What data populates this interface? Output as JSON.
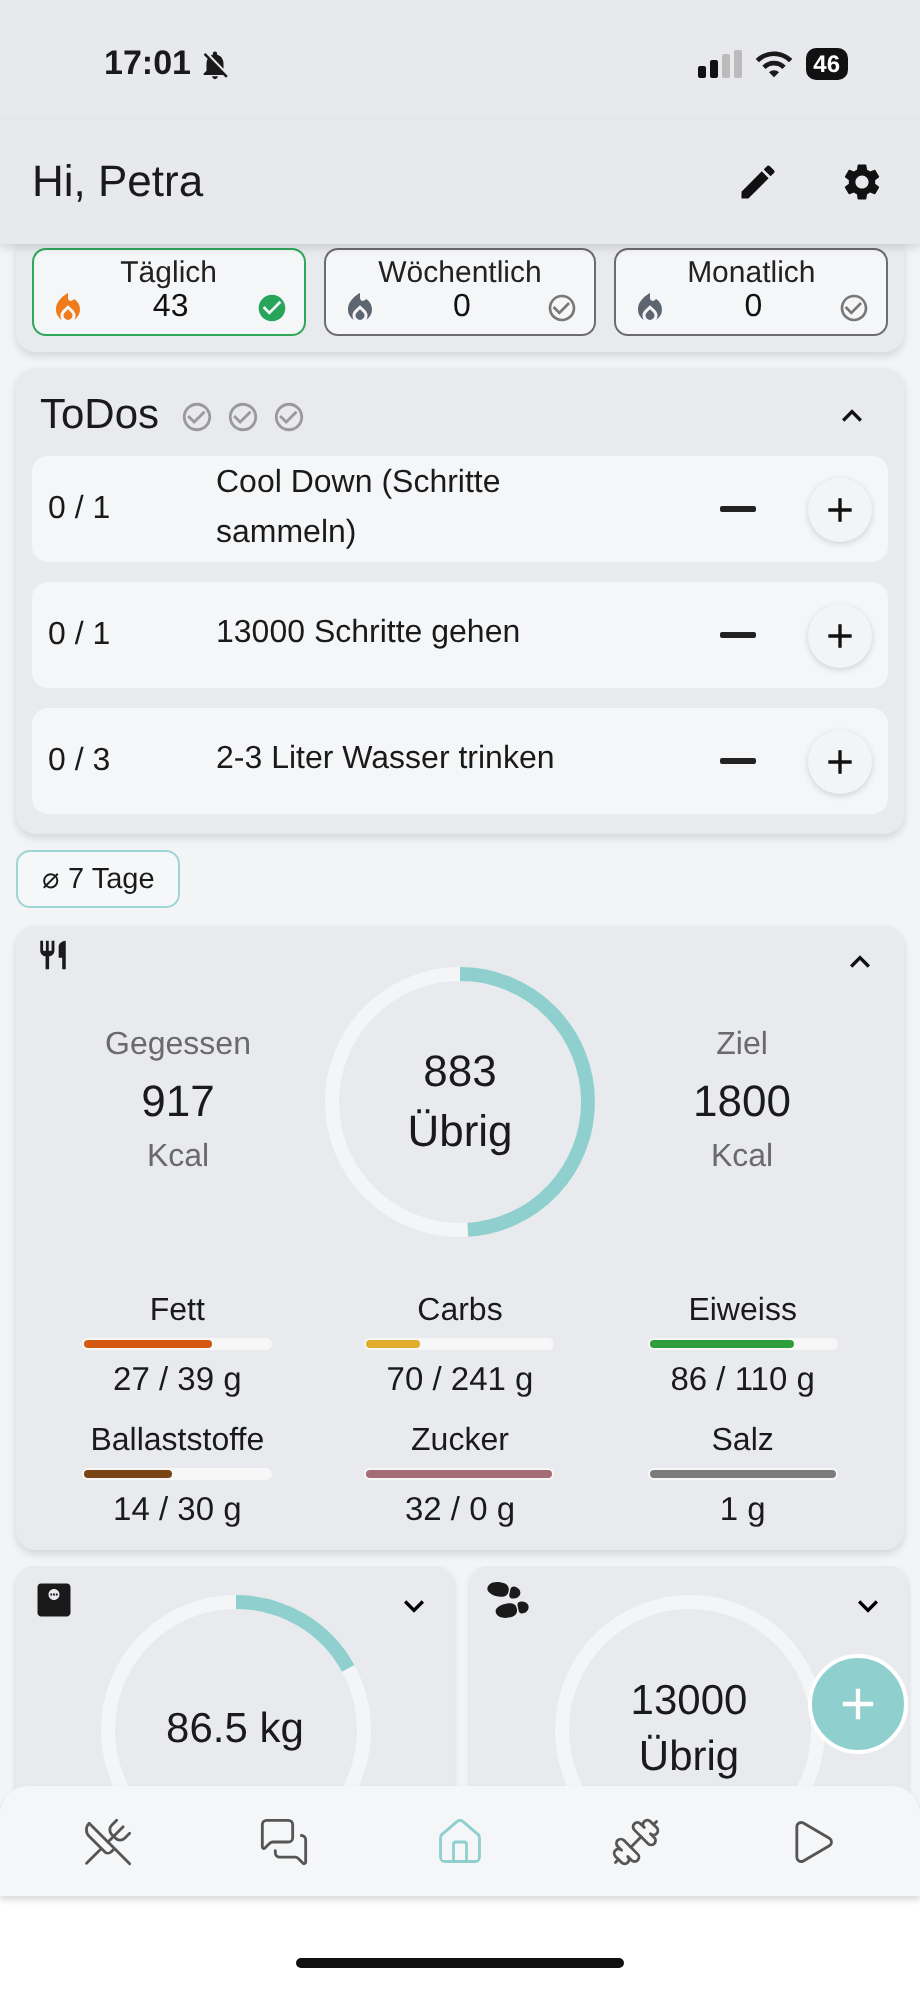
{
  "status_bar": {
    "time": "17:01",
    "battery": "46"
  },
  "header": {
    "greeting": "Hi, Petra"
  },
  "streaks": [
    {
      "label": "Täglich",
      "count": "43",
      "selected": true
    },
    {
      "label": "Wöchentlich",
      "count": "0",
      "selected": false
    },
    {
      "label": "Monatlich",
      "count": "0",
      "selected": false
    }
  ],
  "todos": {
    "title": "ToDos",
    "expanded": true,
    "checks": [
      {
        "checked": false
      },
      {
        "checked": false
      },
      {
        "checked": false
      }
    ],
    "items": [
      {
        "progress": "0 / 1",
        "label": "Cool Down (Schritte sammeln)"
      },
      {
        "progress": "0 / 1",
        "label": "13000 Schritte gehen"
      },
      {
        "progress": "0 / 3",
        "label": "2-3 Liter Wasser trinken"
      }
    ]
  },
  "period_chip": "⌀ 7 Tage",
  "nutrition": {
    "expanded": true,
    "eaten": {
      "label": "Gegessen",
      "value": "917",
      "unit": "Kcal"
    },
    "remaining": {
      "value": "883",
      "label": "Übrig",
      "level": 0.49
    },
    "goal": {
      "label": "Ziel",
      "value": "1800",
      "unit": "Kcal"
    },
    "macros": [
      {
        "name": "Fett",
        "reading": "27 / 39 g",
        "level": 0.69,
        "color": "#d4580f"
      },
      {
        "name": "Carbs",
        "reading": "70 / 241 g",
        "level": 0.29,
        "color": "#e0ad2c"
      },
      {
        "name": "Eiweiss",
        "reading": "86 / 110 g",
        "level": 0.78,
        "color": "#2f9e3a"
      },
      {
        "name": "Ballaststoffe",
        "reading": "14 / 30 g",
        "level": 0.47,
        "color": "#7a4414"
      },
      {
        "name": "Zucker",
        "reading": "32 / 0 g",
        "level": 1,
        "color": "#a46c74"
      },
      {
        "name": "Salz",
        "reading": "1 g",
        "level": 1,
        "color": "#7c7c7c"
      }
    ]
  },
  "tiles": [
    {
      "kind": "weight",
      "expanded": false,
      "lines": [
        "86.5 kg"
      ],
      "level": 0.17
    },
    {
      "kind": "steps",
      "expanded": false,
      "lines": [
        "13000",
        "Übrig"
      ]
    }
  ],
  "nav": [
    {
      "kind": "food",
      "selected": false
    },
    {
      "kind": "chat",
      "selected": false
    },
    {
      "kind": "home",
      "selected": true
    },
    {
      "kind": "workout",
      "selected": false
    },
    {
      "kind": "play",
      "selected": false
    }
  ]
}
